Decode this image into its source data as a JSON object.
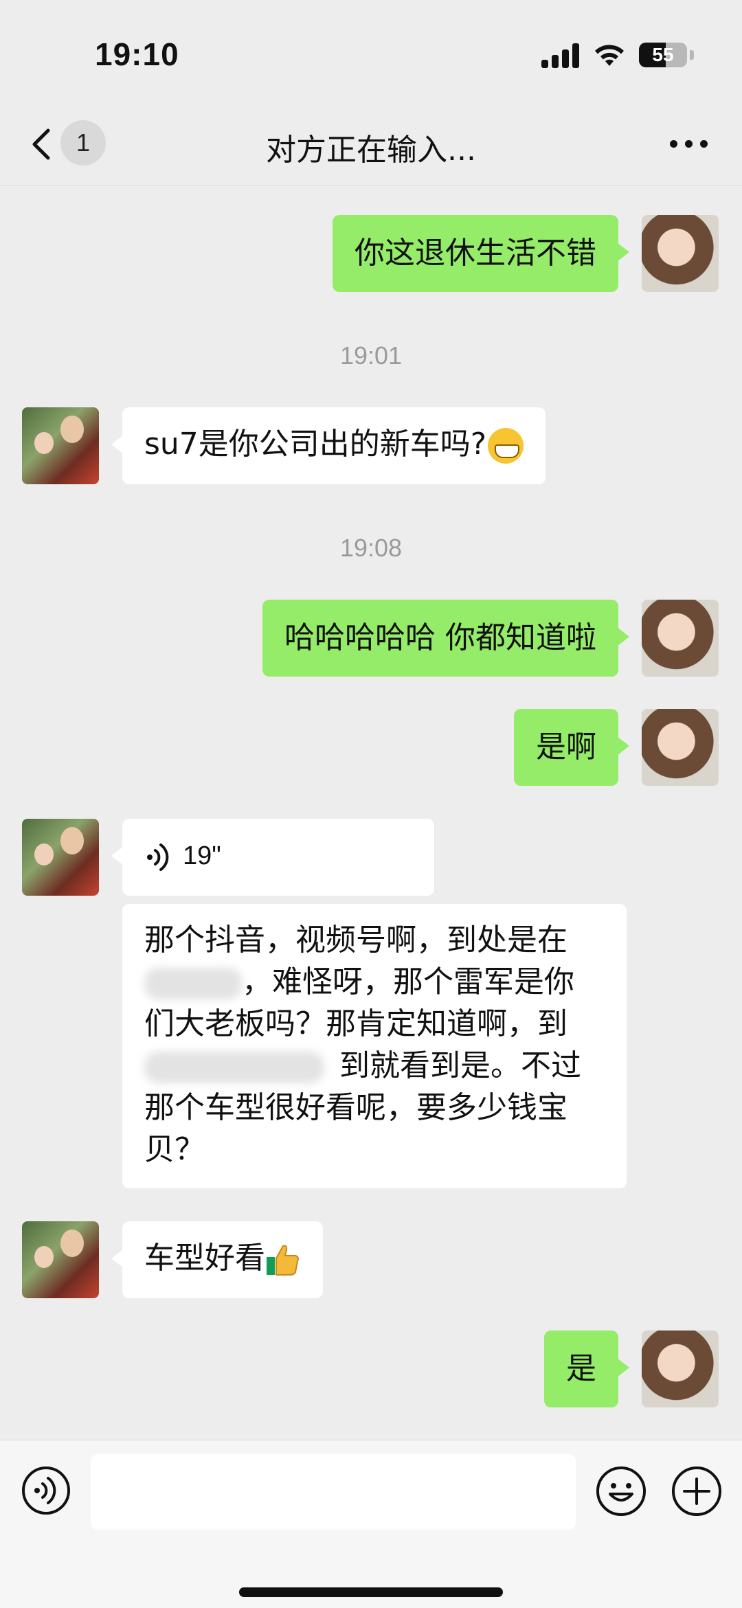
{
  "status_bar": {
    "time": "19:10",
    "battery": "55"
  },
  "nav": {
    "unread_count": "1",
    "title": "对方正在输入..."
  },
  "messages": [
    {
      "side": "sent",
      "text": "你这退休生活不错"
    },
    {
      "type": "timestamp",
      "text": "19:01"
    },
    {
      "side": "received",
      "text": "su7是你公司出的新车吗?",
      "emoji": "grinning-face"
    },
    {
      "type": "timestamp",
      "text": "19:08"
    },
    {
      "side": "sent",
      "text": "哈哈哈哈哈 你都知道啦"
    },
    {
      "side": "sent",
      "text": "是啊"
    },
    {
      "side": "received",
      "type": "voice",
      "duration": "19\""
    },
    {
      "side": "received",
      "type": "transcript",
      "lines": [
        "那个抖音，视频号啊，到处是在",
        "，难怪呀，那个雷军是你",
        "们大老板吗？那肯定知道啊，到",
        "到就看到是。不过",
        "那个车型很好看呢，要多少钱宝",
        "贝？"
      ]
    },
    {
      "side": "received",
      "text": "车型好看",
      "emoji": "thumbs-up"
    },
    {
      "side": "sent",
      "text": "是"
    }
  ],
  "colors": {
    "sent_bubble": "#95ec69",
    "received_bubble": "#ffffff",
    "background": "#ededed"
  }
}
